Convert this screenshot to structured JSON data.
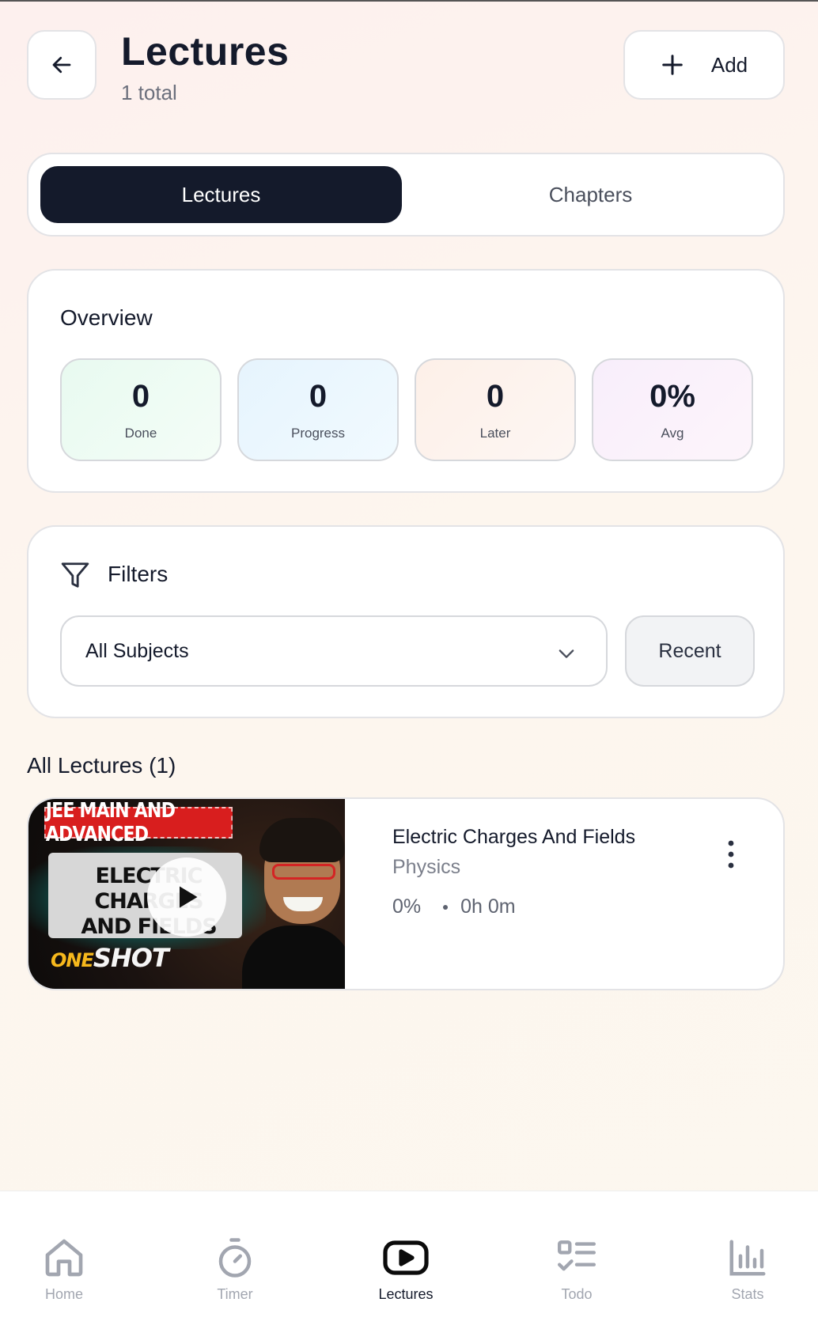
{
  "header": {
    "title": "Lectures",
    "subtitle": "1 total",
    "add_label": "Add"
  },
  "tabs": [
    {
      "label": "Lectures",
      "active": true
    },
    {
      "label": "Chapters",
      "active": false
    }
  ],
  "overview": {
    "title": "Overview",
    "stats": [
      {
        "value": "0",
        "label": "Done"
      },
      {
        "value": "0",
        "label": "Progress"
      },
      {
        "value": "0",
        "label": "Later"
      },
      {
        "value": "0%",
        "label": "Avg"
      }
    ]
  },
  "filters": {
    "title": "Filters",
    "subject_value": "All Subjects",
    "sort_label": "Recent"
  },
  "lectures_section": {
    "title": "All Lectures (1)",
    "items": [
      {
        "title": "Electric Charges And Fields",
        "subject": "Physics",
        "progress": "0%",
        "duration": "0h 0m",
        "thumbnail": {
          "banner": "JEE MAIN AND ADVANCED",
          "board_line1": "ELECTRIC CHARGES",
          "board_line2": "AND FIELDS",
          "tag_one": "ONE",
          "tag_shot": "SHOT"
        }
      }
    ]
  },
  "bottom_nav": [
    {
      "label": "Home",
      "icon": "home-icon",
      "active": false
    },
    {
      "label": "Timer",
      "icon": "timer-icon",
      "active": false
    },
    {
      "label": "Lectures",
      "icon": "play-video-icon",
      "active": true
    },
    {
      "label": "Todo",
      "icon": "checklist-icon",
      "active": false
    },
    {
      "label": "Stats",
      "icon": "bar-chart-icon",
      "active": false
    }
  ],
  "colors": {
    "primary": "#141a2b",
    "muted": "#a2a6b0",
    "border": "#e3e3e6"
  }
}
